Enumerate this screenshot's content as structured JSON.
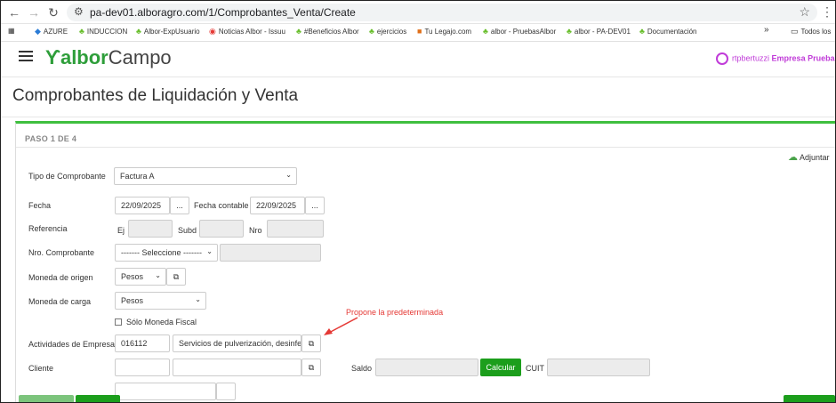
{
  "browser": {
    "url": "pa-dev01.alboragro.com/1/Comprobantes_Venta/Create",
    "bookmarks": [
      "AZURE",
      "INDUCCION",
      "Albor-ExpUsuario",
      "Noticias Albor - Issuu",
      "#Beneficios Albor",
      "ejercicios",
      "Tu Legajo.com",
      "albor - PruebasAlbor",
      "albor - PA-DEV01",
      "Documentación"
    ],
    "more_label": "»",
    "all_bookmarks": "Todos los"
  },
  "app": {
    "logo_prefix": "albor",
    "logo_suffix": "Campo",
    "user_name": "rtpbertuzzi",
    "company": "Empresa Prueba"
  },
  "page": {
    "title": "Comprobantes de Liquidación y Venta",
    "step": "PASO 1 DE 4",
    "attach_label": "Adjuntar"
  },
  "form": {
    "tipo_label": "Tipo de Comprobante",
    "tipo_value": "Factura A",
    "fecha_label": "Fecha",
    "fecha_value": "22/09/2025",
    "fecha_contable_label": "Fecha contable",
    "fecha_contable_value": "22/09/2025",
    "ellipsis": "...",
    "referencia_label": "Referencia",
    "ej_label": "Ej",
    "subd_label": "Subd",
    "nro_label": "Nro",
    "nro_comp_label": "Nro. Comprobante",
    "nro_comp_value": "------- Seleccione -------",
    "moneda_origen_label": "Moneda de origen",
    "moneda_origen_value": "Pesos",
    "moneda_carga_label": "Moneda de carga",
    "moneda_carga_value": "Pesos",
    "solo_moneda_fiscal": "Sólo Moneda Fiscal",
    "actividades_label": "Actividades de Empresa",
    "actividad_codigo": "016112",
    "actividad_desc": "Servicios de pulverización, desinfe",
    "cliente_label": "Cliente",
    "saldo_label": "Saldo",
    "calcular_label": "Calcular",
    "cuit_label": "CUIT"
  },
  "annotation": "Propone la predeterminada"
}
